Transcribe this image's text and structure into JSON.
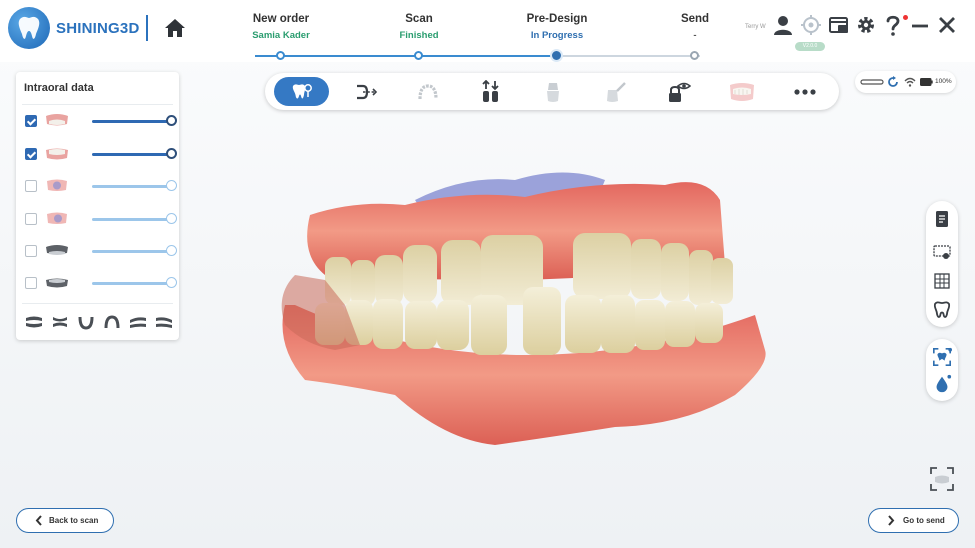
{
  "app": {
    "brand": "SHINING3D",
    "username": "Terry W",
    "version_badge": "V2.0.0"
  },
  "workflow": {
    "steps": [
      {
        "title": "New order",
        "status": "Samia Kader",
        "color": "#2a9d6f"
      },
      {
        "title": "Scan",
        "status": "Finished",
        "color": "#2a9d6f"
      },
      {
        "title": "Pre-Design",
        "status": "In Progress",
        "color": "#2f6fb0"
      },
      {
        "title": "Send",
        "status": "-",
        "color": "#555555"
      }
    ]
  },
  "intraoral_panel": {
    "title": "Intraoral data",
    "rows": [
      {
        "checked": true,
        "icon": "upper-jaw-scan-icon",
        "opacity": 1.0
      },
      {
        "checked": true,
        "icon": "lower-jaw-scan-icon",
        "opacity": 1.0
      },
      {
        "checked": false,
        "icon": "upper-prep-scan-icon",
        "opacity": 1.0
      },
      {
        "checked": false,
        "icon": "lower-prep-scan-icon",
        "opacity": 1.0
      },
      {
        "checked": false,
        "icon": "upper-gingiva-scan-icon",
        "opacity": 1.0
      },
      {
        "checked": false,
        "icon": "lower-gingiva-scan-icon",
        "opacity": 1.0
      }
    ],
    "view_icons": [
      "view-front-icon",
      "view-side-icon",
      "view-upper-icon",
      "view-lower-icon",
      "view-left-icon",
      "view-right-icon"
    ]
  },
  "toolbar": {
    "tools": [
      "tooth-select-icon",
      "margin-line-icon",
      "arch-icon",
      "insertion-direction-icon",
      "prep-tooth-icon",
      "tooth-cut-icon",
      "visibility-lock-icon",
      "gingiva-icon",
      "more-icon"
    ]
  },
  "device_status": {
    "battery": "100%"
  },
  "actions": {
    "back": "Back to scan",
    "next": "Go to send"
  },
  "colors": {
    "accent": "#2f6fb0",
    "success": "#2a9d6f",
    "notification": "#e33333"
  }
}
